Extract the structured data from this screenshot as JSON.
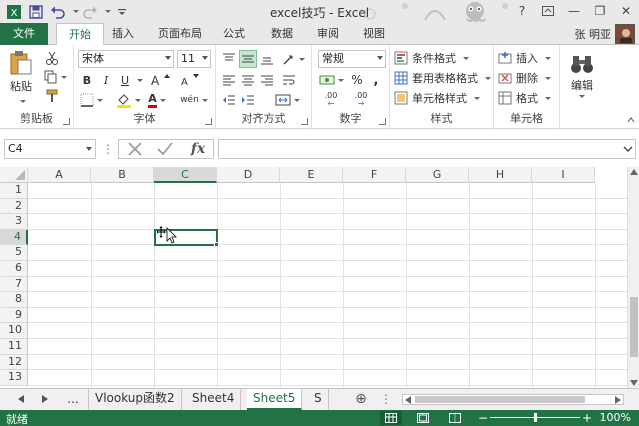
{
  "window": {
    "title": "excel技巧 - Excel",
    "user": "张 明亚"
  },
  "qat": {
    "save_icon": "save-icon",
    "undo_icon": "undo-icon",
    "redo_icon": "redo-icon",
    "customize_icon": "customize-qat-icon"
  },
  "window_controls": {
    "help": "?",
    "minimize": "—",
    "restore": "❐",
    "close": "✕"
  },
  "tabs": [
    {
      "label": "文件",
      "type": "file"
    },
    {
      "label": "开始",
      "active": true
    },
    {
      "label": "插入"
    },
    {
      "label": "页面布局"
    },
    {
      "label": "公式"
    },
    {
      "label": "数据"
    },
    {
      "label": "审阅"
    },
    {
      "label": "视图"
    }
  ],
  "ribbon": {
    "clipboard": {
      "label": "剪贴板",
      "paste": "粘贴"
    },
    "font": {
      "label": "字体",
      "name": "宋体",
      "size": "11",
      "bold": "B",
      "italic": "I",
      "underline": "U",
      "fontcolor": "A",
      "phonetic": "wén"
    },
    "alignment": {
      "label": "对齐方式"
    },
    "number": {
      "label": "数字",
      "format": "常规",
      "percent": "%",
      "comma": ",",
      "inc_decimal": ".00",
      "dec_decimal": ".00"
    },
    "styles": {
      "label": "样式",
      "conditional": "条件格式",
      "table": "套用表格格式",
      "cell": "单元格样式"
    },
    "cells": {
      "label": "单元格",
      "insert": "插入",
      "delete": "删除",
      "format": "格式"
    },
    "editing": {
      "label": "编辑"
    }
  },
  "formula_bar": {
    "name_box": "C4",
    "fx": "fx",
    "formula": ""
  },
  "grid": {
    "columns": [
      "A",
      "B",
      "C",
      "D",
      "E",
      "F",
      "G",
      "H",
      "I"
    ],
    "rows": [
      "1",
      "2",
      "3",
      "4",
      "5",
      "6",
      "7",
      "8",
      "9",
      "10",
      "11",
      "12",
      "13"
    ],
    "selected_col": "C",
    "selected_row": "4"
  },
  "sheets": {
    "ellipsis": "...",
    "items": [
      {
        "label": "Vlookup函数2"
      },
      {
        "label": "Sheet4"
      },
      {
        "label": "Sheet5",
        "active": true
      },
      {
        "label": "S"
      }
    ],
    "add": "⊕",
    "more": "⋮"
  },
  "status": {
    "ready": "就绪",
    "zoom": "100%",
    "zoom_level": 1.0
  },
  "colors": {
    "accent": "#217346"
  }
}
